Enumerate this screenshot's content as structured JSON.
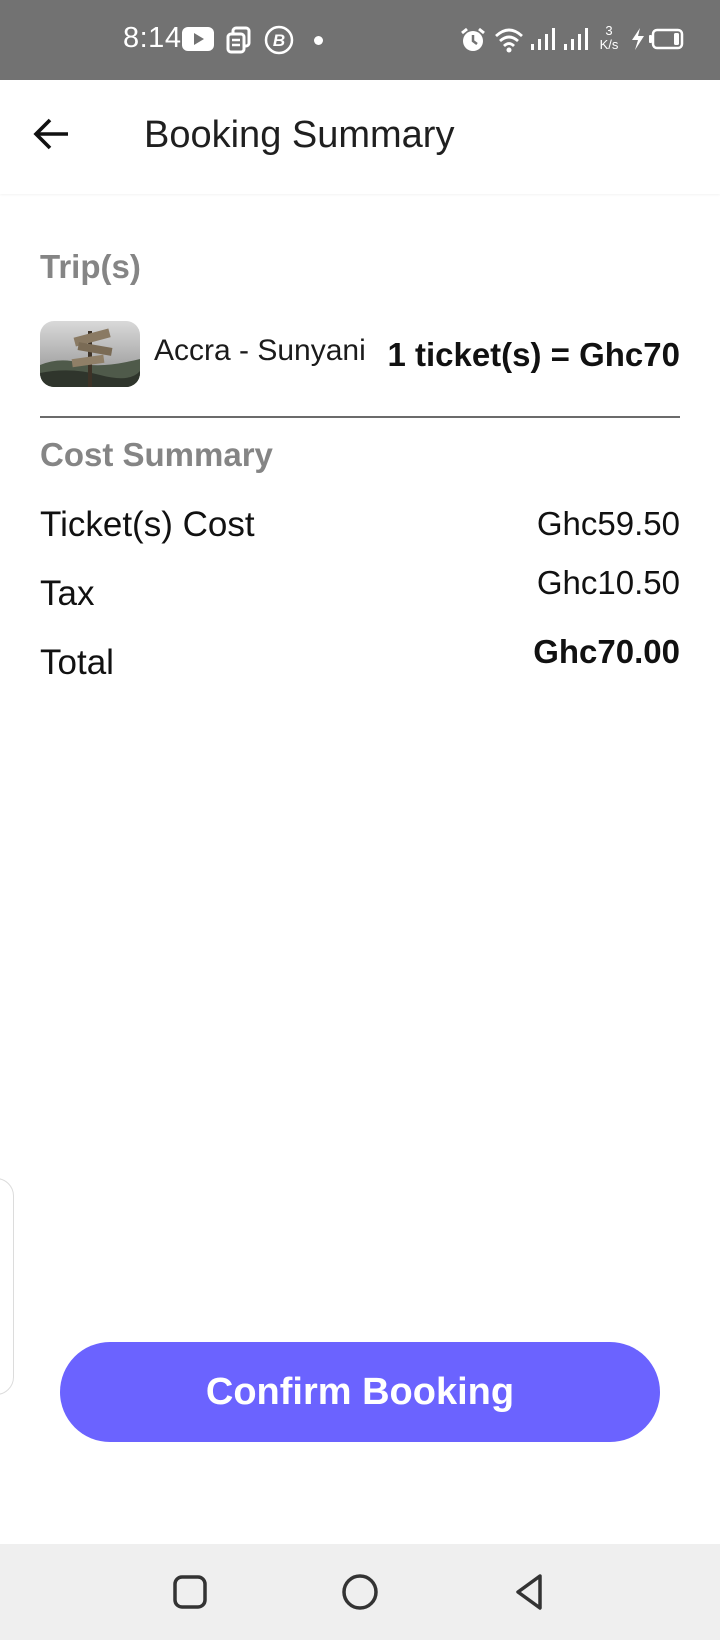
{
  "status_bar": {
    "time": "8:14",
    "net_speed_value": "3",
    "net_speed_unit": "K/s",
    "icons": [
      "youtube-icon",
      "sms-icon",
      "bitcoin-icon",
      "dot-icon",
      "alarm-icon",
      "wifi-icon",
      "signal-icon",
      "signal-icon",
      "charging-icon",
      "battery-icon"
    ]
  },
  "header": {
    "title": "Booking Summary",
    "back_icon": "arrow-left-icon"
  },
  "trips": {
    "section_title": "Trip(s)",
    "items": [
      {
        "route": "Accra - Sunyani",
        "price": "1 ticket(s) = Ghc70",
        "thumbnail": "signpost-photo"
      }
    ]
  },
  "cost_summary": {
    "section_title": "Cost Summary",
    "rows": [
      {
        "label": "Ticket(s) Cost",
        "value": "Ghc59.50"
      },
      {
        "label": "Tax",
        "value": "Ghc10.50"
      },
      {
        "label": "Total",
        "value": "Ghc70.00"
      }
    ]
  },
  "actions": {
    "confirm_label": "Confirm Booking"
  },
  "colors": {
    "accent": "#6b63ff",
    "status_bar": "#727272",
    "section_title": "#858585",
    "nav_bar": "#efefef"
  },
  "nav_bar": {
    "buttons": [
      "recent-apps-icon",
      "home-icon",
      "back-triangle-icon"
    ]
  }
}
